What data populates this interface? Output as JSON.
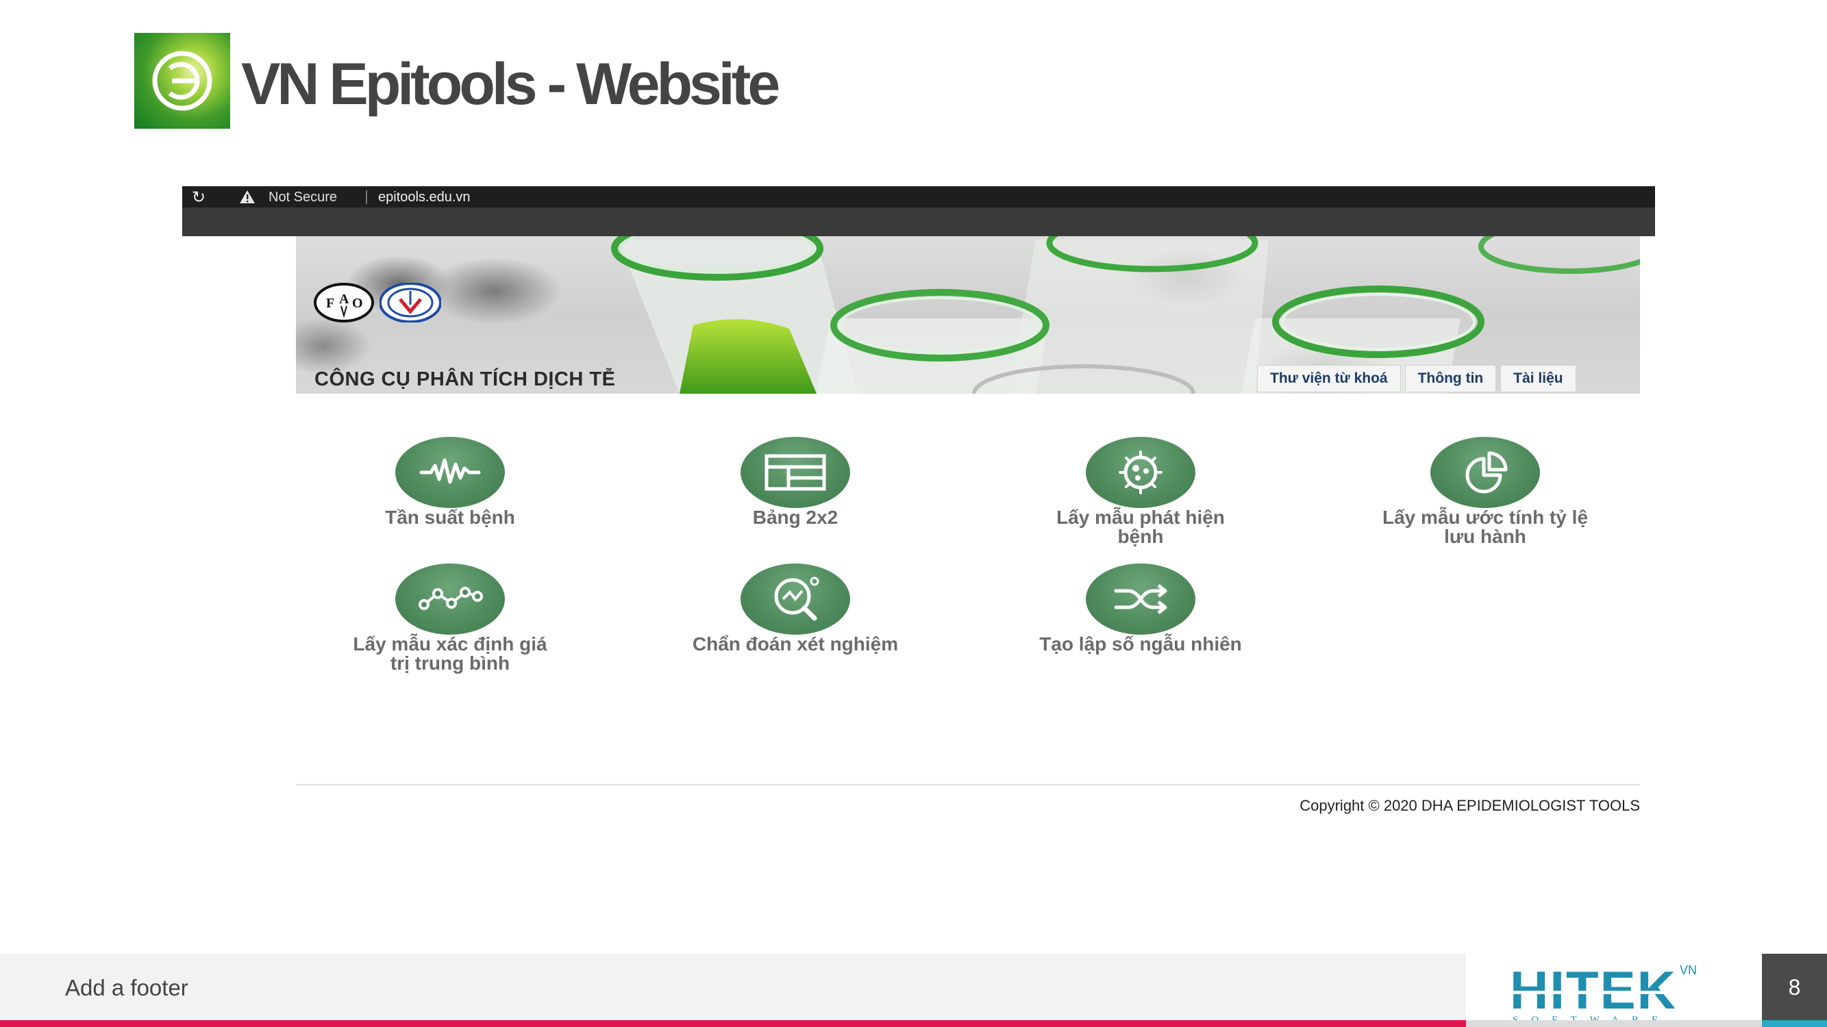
{
  "slide": {
    "title": "VN Epitools - Website",
    "footer_text": "Add a footer",
    "page_number": "8",
    "company_logo_text": "HITEK",
    "company_logo_sub": "SOFTWARE",
    "company_logo_vn": "VN"
  },
  "browser": {
    "security_label": "Not Secure",
    "url": "epitools.edu.vn"
  },
  "site": {
    "banner_title": "CÔNG CỤ PHÂN TÍCH DỊCH TỄ",
    "nav": [
      "Thư viện từ khoá",
      "Thông tin",
      "Tài liệu"
    ],
    "tools": [
      {
        "label_1": "Tần suất bệnh",
        "label_2": "",
        "icon": "waveform-icon"
      },
      {
        "label_1": "Bảng 2x2",
        "label_2": "",
        "icon": "table-icon"
      },
      {
        "label_1": "Lấy mẫu phát hiện",
        "label_2": "bệnh",
        "icon": "virus-icon"
      },
      {
        "label_1": "Lấy mẫu ước tính tỷ lệ",
        "label_2": "lưu hành",
        "icon": "pie-chart-icon"
      },
      {
        "label_1": "Lấy mẫu xác định giá",
        "label_2": "trị trung bình",
        "icon": "line-graph-icon"
      },
      {
        "label_1": "Chẩn đoán xét nghiệm",
        "label_2": "",
        "icon": "magnifier-chart-icon"
      },
      {
        "label_1": "Tạo lập số ngẫu nhiên",
        "label_2": "",
        "icon": "shuffle-icon"
      }
    ],
    "copyright": "Copyright © 2020 DHA EPIDEMIOLOGIST TOOLS"
  },
  "colors": {
    "accent_green": "#4f8b5d",
    "footer_red": "#e2144f",
    "brand_teal": "#1f8fb0"
  }
}
